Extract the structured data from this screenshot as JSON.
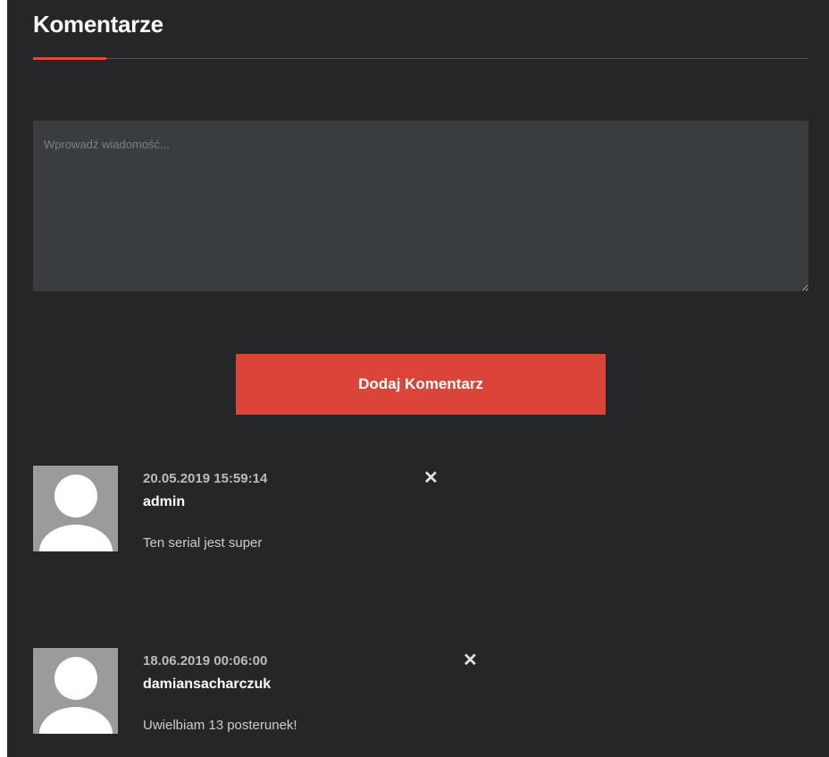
{
  "section": {
    "title": "Komentarze"
  },
  "form": {
    "placeholder": "Wprowadź wiadomość...",
    "submit_label": "Dodaj Komentarz"
  },
  "colors": {
    "accent": "#db4439",
    "background": "#242628"
  },
  "comments": [
    {
      "date": "20.05.2019 15:59:14",
      "user": "admin",
      "text": "Ten serial jest super",
      "delete": "✕"
    },
    {
      "date": "18.06.2019 00:06:00",
      "user": "damiansacharczuk",
      "text": "Uwielbiam 13 posterunek!",
      "delete": "✕"
    }
  ]
}
